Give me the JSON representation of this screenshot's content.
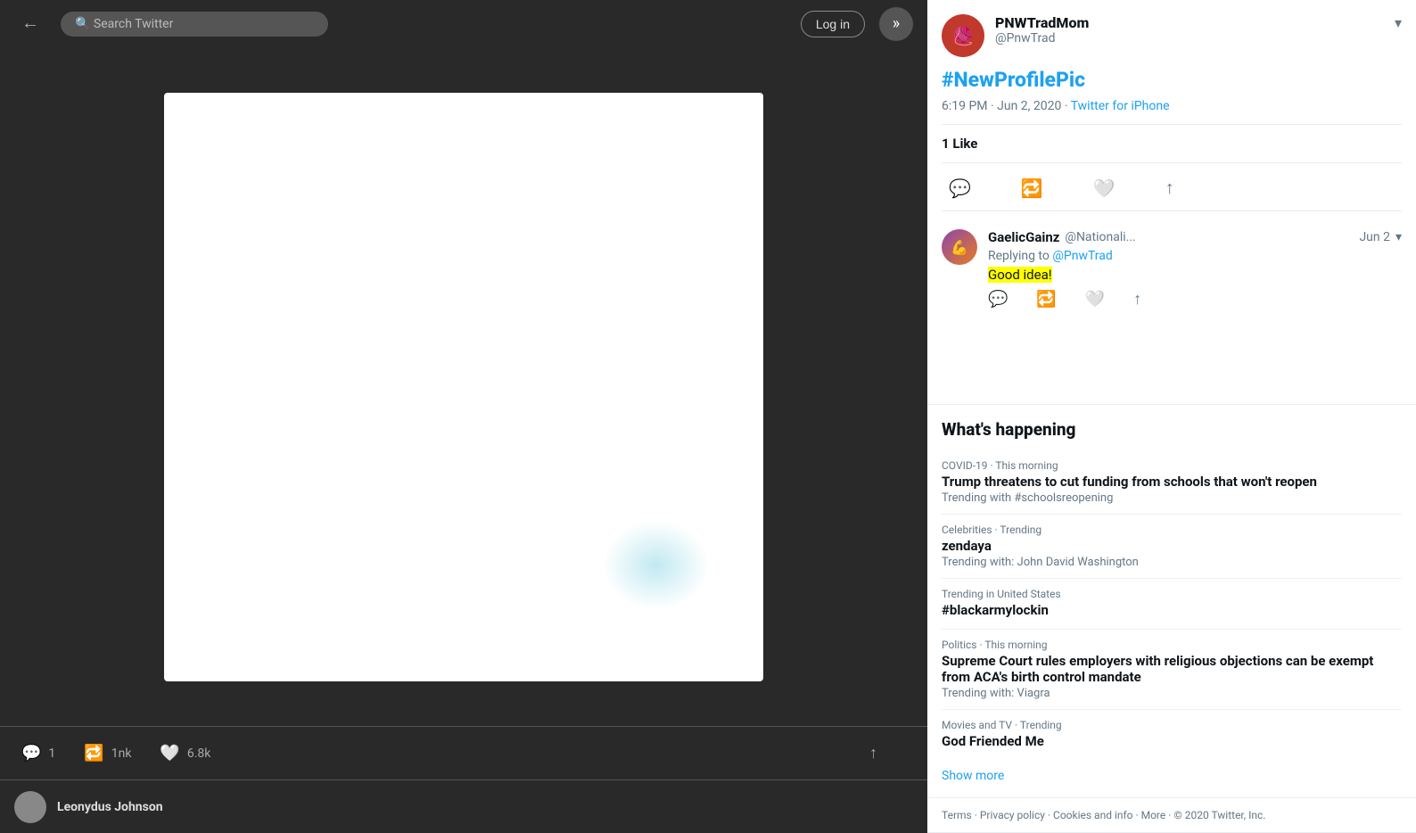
{
  "topBar": {
    "backLabel": "←",
    "searchPlaceholder": "Search Twitter",
    "logInLabel": "Log in",
    "moreLabel": "»"
  },
  "imageArea": {
    "altText": "Tweet image - white background"
  },
  "bottomBar": {
    "replyCount": "1",
    "retweetCount": "1nk",
    "likeCount": "6.8k",
    "shareLabel": "↑"
  },
  "bottomTweet": {
    "author": "Leonydus Johnson"
  },
  "trending": {
    "title": "What's happening",
    "items": [
      {
        "category": "COVID-19 · This morning",
        "topic": "Trump threatens to cut funding from schools that won't reopen",
        "sub": "Trending with #schoolsreopening"
      },
      {
        "category": "Celebrities · Trending",
        "topic": "zendaya",
        "sub": "Trending with: John David Washington"
      },
      {
        "category": "Trending in United States",
        "topic": "#blackarmylockin",
        "sub": ""
      },
      {
        "category": "Politics · This morning",
        "topic": "Supreme Court rules employers with religious objections can be exempt from ACA's birth control mandate",
        "sub": "Trending with: Viagra"
      },
      {
        "category": "Movies and TV · Trending",
        "topic": "God Friended Me",
        "sub": ""
      }
    ],
    "showMore": "Show more",
    "footer": "Terms · Privacy policy · Cookies and info · More · © 2020 Twitter, Inc."
  },
  "tweetDetail": {
    "displayName": "PNWTradMom",
    "username": "@PnwTrad",
    "hashtag": "#NewProfilePic",
    "timestamp": "6:19 PM · Jun 2, 2020",
    "via": "Twitter for iPhone",
    "likes": "1",
    "likesLabel": "Like",
    "replyIconLabel": "reply",
    "retweetIconLabel": "retweet",
    "likeIconLabel": "like",
    "shareIconLabel": "share"
  },
  "reply": {
    "name": "GaelicGainz",
    "username": "@Nationali...",
    "date": "Jun 2",
    "replyingTo": "@PnwTrad",
    "text": "Good idea!",
    "replyIconLabel": "reply",
    "retweetIconLabel": "retweet",
    "likeIconLabel": "like",
    "shareIconLabel": "share"
  }
}
